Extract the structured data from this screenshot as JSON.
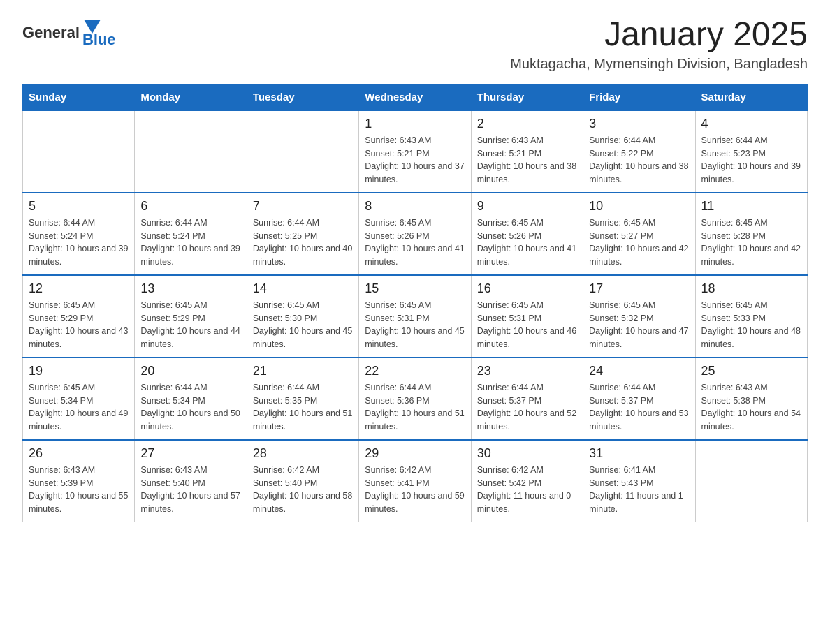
{
  "logo": {
    "general": "General",
    "blue": "Blue"
  },
  "header": {
    "title": "January 2025",
    "subtitle": "Muktagacha, Mymensingh Division, Bangladesh"
  },
  "weekdays": [
    "Sunday",
    "Monday",
    "Tuesday",
    "Wednesday",
    "Thursday",
    "Friday",
    "Saturday"
  ],
  "weeks": [
    [
      {
        "day": "",
        "info": ""
      },
      {
        "day": "",
        "info": ""
      },
      {
        "day": "",
        "info": ""
      },
      {
        "day": "1",
        "info": "Sunrise: 6:43 AM\nSunset: 5:21 PM\nDaylight: 10 hours and 37 minutes."
      },
      {
        "day": "2",
        "info": "Sunrise: 6:43 AM\nSunset: 5:21 PM\nDaylight: 10 hours and 38 minutes."
      },
      {
        "day": "3",
        "info": "Sunrise: 6:44 AM\nSunset: 5:22 PM\nDaylight: 10 hours and 38 minutes."
      },
      {
        "day": "4",
        "info": "Sunrise: 6:44 AM\nSunset: 5:23 PM\nDaylight: 10 hours and 39 minutes."
      }
    ],
    [
      {
        "day": "5",
        "info": "Sunrise: 6:44 AM\nSunset: 5:24 PM\nDaylight: 10 hours and 39 minutes."
      },
      {
        "day": "6",
        "info": "Sunrise: 6:44 AM\nSunset: 5:24 PM\nDaylight: 10 hours and 39 minutes."
      },
      {
        "day": "7",
        "info": "Sunrise: 6:44 AM\nSunset: 5:25 PM\nDaylight: 10 hours and 40 minutes."
      },
      {
        "day": "8",
        "info": "Sunrise: 6:45 AM\nSunset: 5:26 PM\nDaylight: 10 hours and 41 minutes."
      },
      {
        "day": "9",
        "info": "Sunrise: 6:45 AM\nSunset: 5:26 PM\nDaylight: 10 hours and 41 minutes."
      },
      {
        "day": "10",
        "info": "Sunrise: 6:45 AM\nSunset: 5:27 PM\nDaylight: 10 hours and 42 minutes."
      },
      {
        "day": "11",
        "info": "Sunrise: 6:45 AM\nSunset: 5:28 PM\nDaylight: 10 hours and 42 minutes."
      }
    ],
    [
      {
        "day": "12",
        "info": "Sunrise: 6:45 AM\nSunset: 5:29 PM\nDaylight: 10 hours and 43 minutes."
      },
      {
        "day": "13",
        "info": "Sunrise: 6:45 AM\nSunset: 5:29 PM\nDaylight: 10 hours and 44 minutes."
      },
      {
        "day": "14",
        "info": "Sunrise: 6:45 AM\nSunset: 5:30 PM\nDaylight: 10 hours and 45 minutes."
      },
      {
        "day": "15",
        "info": "Sunrise: 6:45 AM\nSunset: 5:31 PM\nDaylight: 10 hours and 45 minutes."
      },
      {
        "day": "16",
        "info": "Sunrise: 6:45 AM\nSunset: 5:31 PM\nDaylight: 10 hours and 46 minutes."
      },
      {
        "day": "17",
        "info": "Sunrise: 6:45 AM\nSunset: 5:32 PM\nDaylight: 10 hours and 47 minutes."
      },
      {
        "day": "18",
        "info": "Sunrise: 6:45 AM\nSunset: 5:33 PM\nDaylight: 10 hours and 48 minutes."
      }
    ],
    [
      {
        "day": "19",
        "info": "Sunrise: 6:45 AM\nSunset: 5:34 PM\nDaylight: 10 hours and 49 minutes."
      },
      {
        "day": "20",
        "info": "Sunrise: 6:44 AM\nSunset: 5:34 PM\nDaylight: 10 hours and 50 minutes."
      },
      {
        "day": "21",
        "info": "Sunrise: 6:44 AM\nSunset: 5:35 PM\nDaylight: 10 hours and 51 minutes."
      },
      {
        "day": "22",
        "info": "Sunrise: 6:44 AM\nSunset: 5:36 PM\nDaylight: 10 hours and 51 minutes."
      },
      {
        "day": "23",
        "info": "Sunrise: 6:44 AM\nSunset: 5:37 PM\nDaylight: 10 hours and 52 minutes."
      },
      {
        "day": "24",
        "info": "Sunrise: 6:44 AM\nSunset: 5:37 PM\nDaylight: 10 hours and 53 minutes."
      },
      {
        "day": "25",
        "info": "Sunrise: 6:43 AM\nSunset: 5:38 PM\nDaylight: 10 hours and 54 minutes."
      }
    ],
    [
      {
        "day": "26",
        "info": "Sunrise: 6:43 AM\nSunset: 5:39 PM\nDaylight: 10 hours and 55 minutes."
      },
      {
        "day": "27",
        "info": "Sunrise: 6:43 AM\nSunset: 5:40 PM\nDaylight: 10 hours and 57 minutes."
      },
      {
        "day": "28",
        "info": "Sunrise: 6:42 AM\nSunset: 5:40 PM\nDaylight: 10 hours and 58 minutes."
      },
      {
        "day": "29",
        "info": "Sunrise: 6:42 AM\nSunset: 5:41 PM\nDaylight: 10 hours and 59 minutes."
      },
      {
        "day": "30",
        "info": "Sunrise: 6:42 AM\nSunset: 5:42 PM\nDaylight: 11 hours and 0 minutes."
      },
      {
        "day": "31",
        "info": "Sunrise: 6:41 AM\nSunset: 5:43 PM\nDaylight: 11 hours and 1 minute."
      },
      {
        "day": "",
        "info": ""
      }
    ]
  ]
}
